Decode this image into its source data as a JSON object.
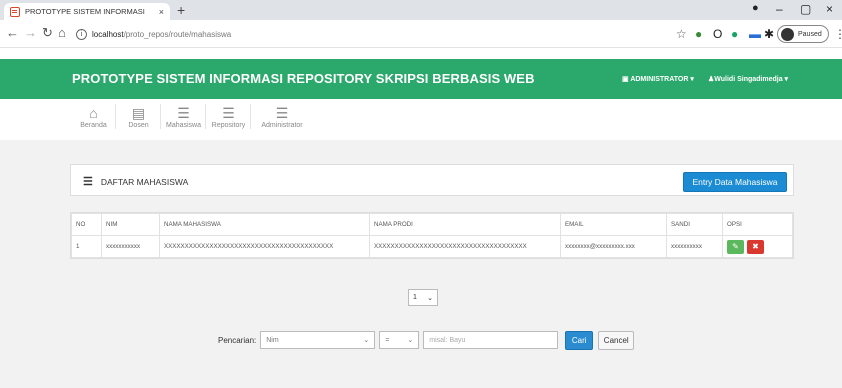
{
  "browser": {
    "tab_title": "PROTOTYPE SISTEM INFORMASI",
    "tab_close": "×",
    "new_tab": "+",
    "url_host": "localhost",
    "url_path": "/proto_repos/route/mahasiswa",
    "paused_label": "Paused",
    "win_min": "–",
    "win_max": "▢",
    "win_close": "×"
  },
  "header": {
    "title": "PROTOTYPE SISTEM INFORMASI REPOSITORY SKRIPSI BERBASIS WEB",
    "role_menu": "ADMINISTRATOR",
    "user_menu": "Wulidi Singadimedja"
  },
  "nav": [
    {
      "label": "Beranda",
      "icon": "home-icon"
    },
    {
      "label": "Dosen",
      "icon": "list-icon"
    },
    {
      "label": "Mahasiswa",
      "icon": "list-icon"
    },
    {
      "label": "Repository",
      "icon": "list-icon"
    },
    {
      "label": "Administrator",
      "icon": "list-icon"
    }
  ],
  "panel": {
    "title": "DAFTAR MAHASISWA",
    "entry_button": "Entry Data Mahasiswa"
  },
  "table": {
    "headers": [
      "NO",
      "NIM",
      "NAMA MAHASISWA",
      "NAMA PRODI",
      "EMAIL",
      "SANDI",
      "OPSI"
    ],
    "rows": [
      [
        "1",
        "xxxxxxxxxxx",
        "XXXXXXXXXXXXXXXXXXXXXXXXXXXXXXXXXXXXXXXXX",
        "XXXXXXXXXXXXXXXXXXXXXXXXXXXXXXXXXXXXX",
        "xxxxxxxx@xxxxxxxxx.xxx",
        "xxxxxxxxxx"
      ]
    ]
  },
  "pager": {
    "value": "1"
  },
  "search": {
    "label": "Pencarian:",
    "field_value": "Nim",
    "operator_value": "=",
    "input_placeholder": "misal: Bayu",
    "cari_label": "Cari",
    "cancel_label": "Cancel"
  },
  "colors": {
    "header_green": "#2ba86b",
    "primary_blue": "#1b8bd3",
    "edit_green": "#5cb85c",
    "delete_red": "#d9382f"
  }
}
